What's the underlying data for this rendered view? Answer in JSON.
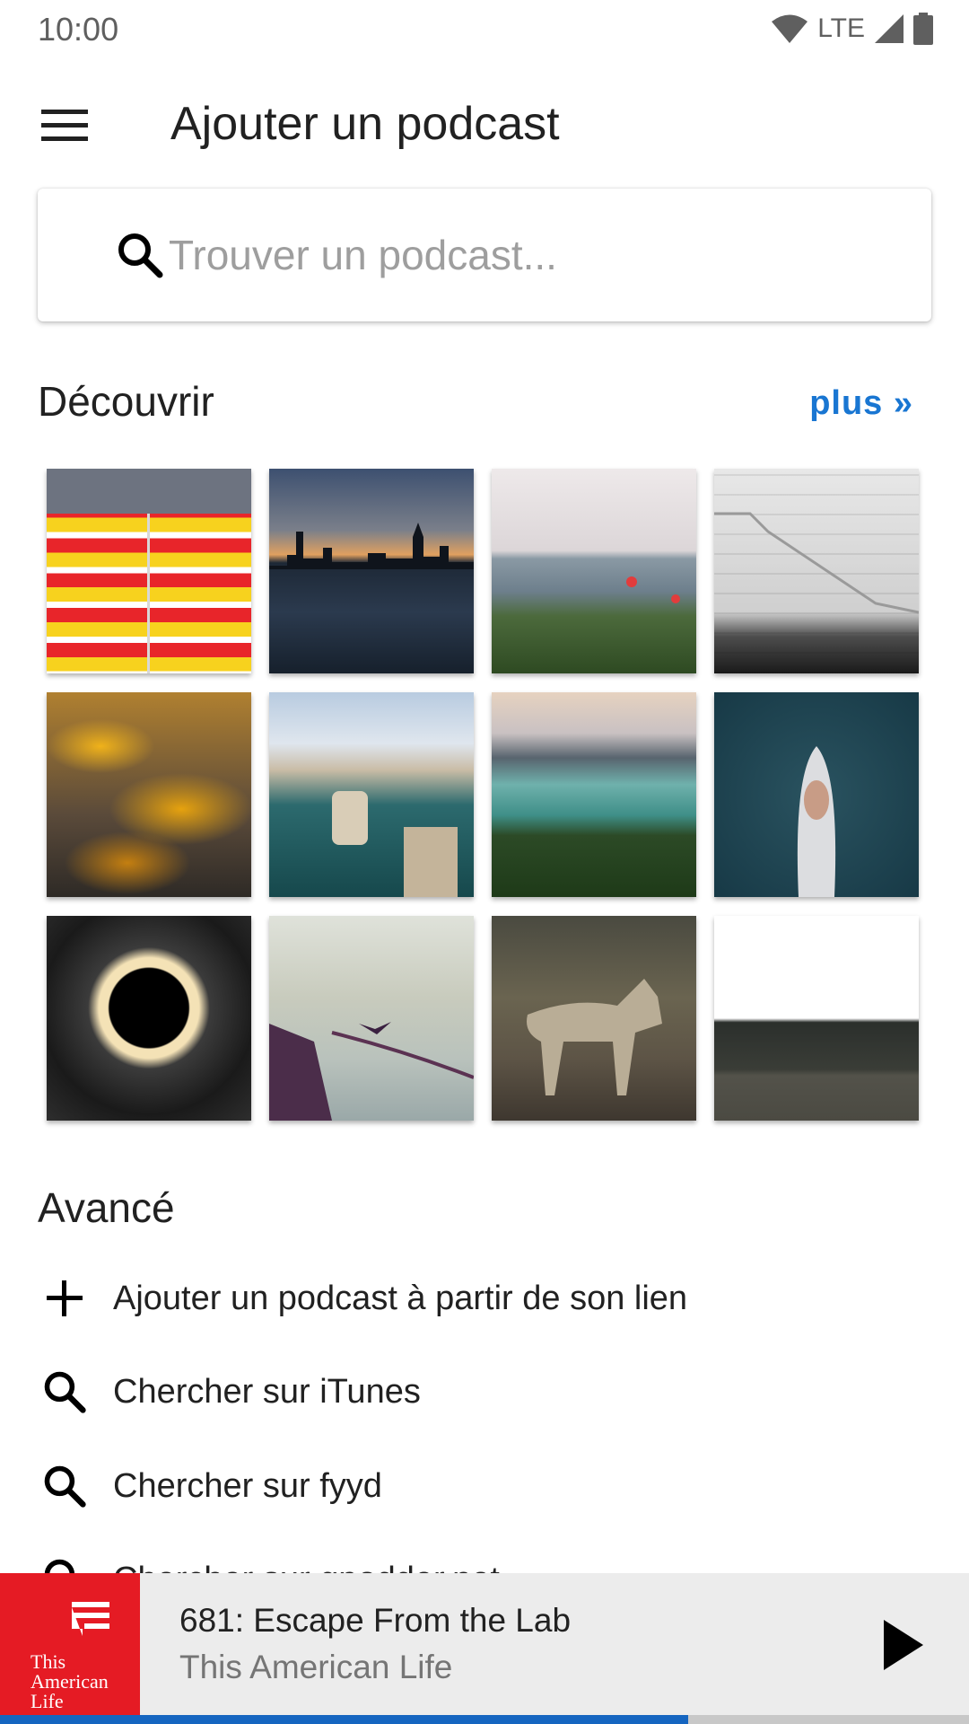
{
  "status_bar": {
    "time": "10:00",
    "network": "LTE"
  },
  "app_bar": {
    "title": "Ajouter un podcast",
    "menu_icon": "menu-icon"
  },
  "search": {
    "placeholder": "Trouver un podcast...",
    "value": ""
  },
  "discover": {
    "title": "Découvrir",
    "more_label": "plus »",
    "tiles": [
      {
        "name": "striped-wall"
      },
      {
        "name": "city-skyline-sunset"
      },
      {
        "name": "seaside-flowers"
      },
      {
        "name": "stone-steps"
      },
      {
        "name": "autumn-leaves"
      },
      {
        "name": "sea-cliffs"
      },
      {
        "name": "mountain-lake"
      },
      {
        "name": "boat-aerial"
      },
      {
        "name": "light-circle"
      },
      {
        "name": "boat-and-bird"
      },
      {
        "name": "coyote"
      },
      {
        "name": "forest-horizon"
      }
    ]
  },
  "advanced": {
    "title": "Avancé",
    "items": [
      {
        "label": "Ajouter un podcast à partir de son lien",
        "icon": "plus-icon"
      },
      {
        "label": "Chercher sur iTunes",
        "icon": "search-icon"
      },
      {
        "label": "Chercher sur fyyd",
        "icon": "search-icon"
      },
      {
        "label": "Chercher sur gpodder.net",
        "icon": "search-icon"
      }
    ]
  },
  "player": {
    "episode_title": "681: Escape From the Lab",
    "podcast_name": "This American Life",
    "art_text": [
      "This",
      "American",
      "Life"
    ],
    "progress": 0.71,
    "colors": {
      "art_bg": "#e51b24",
      "progress": "#1565c0"
    }
  },
  "colors": {
    "accent": "#1976d2"
  }
}
